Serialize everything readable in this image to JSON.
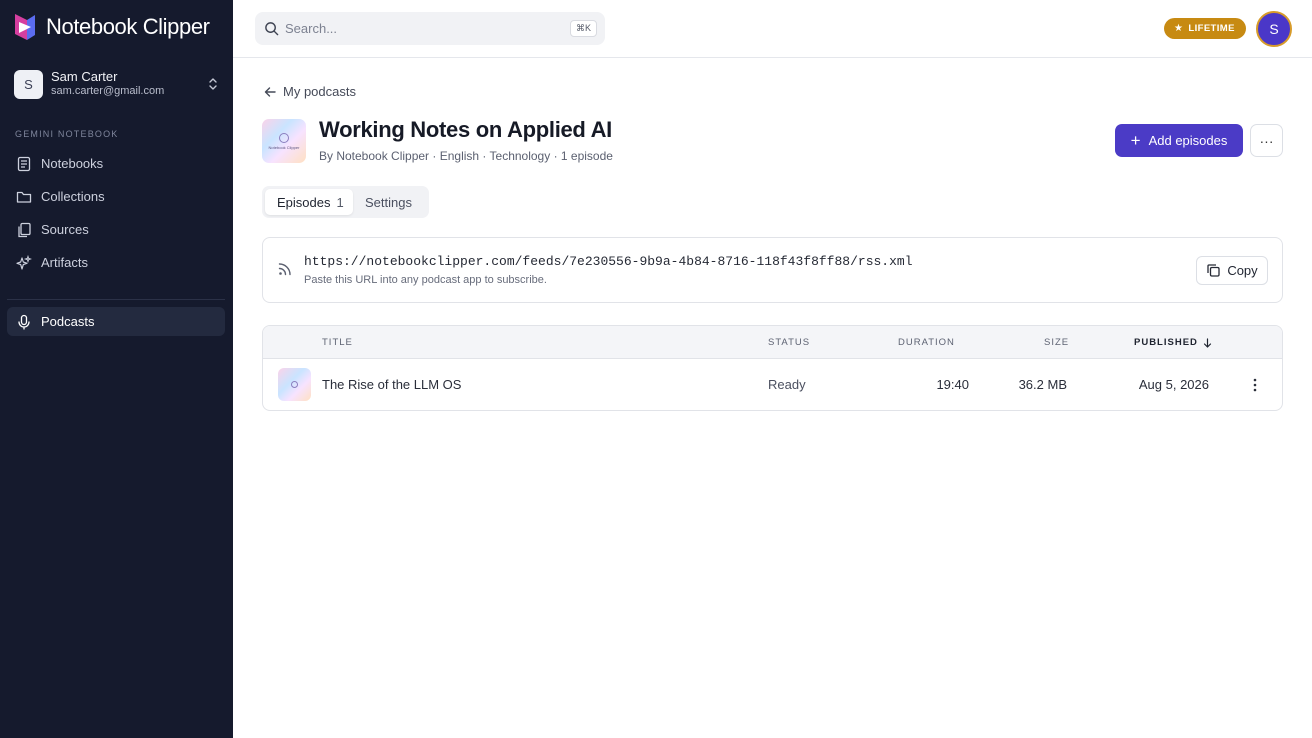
{
  "brand": {
    "name": "Notebook Clipper"
  },
  "account": {
    "initial": "S",
    "name": "Sam Carter",
    "email": "sam.carter@gmail.com"
  },
  "sidebar": {
    "section_label": "GEMINI NOTEBOOK",
    "items": [
      {
        "label": "Notebooks",
        "icon": "notebook-icon"
      },
      {
        "label": "Collections",
        "icon": "folder-icon"
      },
      {
        "label": "Sources",
        "icon": "files-icon"
      },
      {
        "label": "Artifacts",
        "icon": "sparkles-icon"
      }
    ],
    "active_item": {
      "label": "Podcasts",
      "icon": "microphone-icon"
    }
  },
  "search": {
    "placeholder": "Search...",
    "shortcut": "⌘K"
  },
  "plan_badge": {
    "label": "LIFETIME",
    "color": "#c78a12"
  },
  "user": {
    "initial": "S",
    "avatar_color": "#4a37c8"
  },
  "breadcrumb": {
    "back_label": "My podcasts"
  },
  "podcast": {
    "title": "Working Notes on Applied AI",
    "meta": "By Notebook Clipper · English · Technology · 1 episode",
    "cover_text": "Notebook Clipper"
  },
  "actions": {
    "add_label": "Add episodes",
    "more_label": "···",
    "accent": "#4b3bc6"
  },
  "tabs": [
    {
      "label": "Episodes",
      "count": "1"
    },
    {
      "label": "Settings"
    }
  ],
  "feed": {
    "url": "https://notebookclipper.com/feeds/7e230556-9b9a-4b84-8716-118f43f8ff88/rss.xml",
    "hint": "Paste this URL into any podcast app to subscribe.",
    "copy_label": "Copy"
  },
  "table": {
    "columns": {
      "title": "TITLE",
      "status": "STATUS",
      "duration": "DURATION",
      "size": "SIZE",
      "published": "PUBLISHED"
    },
    "sort": {
      "column": "published",
      "direction": "descending"
    },
    "rows": [
      {
        "title": "The Rise of the LLM OS",
        "status": "Ready",
        "duration": "19:40",
        "size": "36.2 MB",
        "published": "Aug 5, 2026"
      }
    ]
  }
}
